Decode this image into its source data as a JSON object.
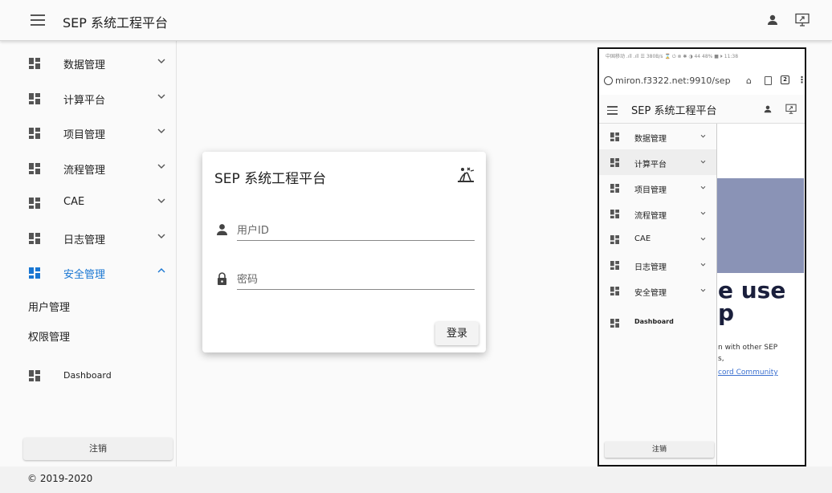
{
  "appbar": {
    "title": "SEP 系统工程平台",
    "icons": [
      "menu-icon",
      "user-icon",
      "screen-share-icon"
    ]
  },
  "sidebar": {
    "items": [
      {
        "label": "数据管理",
        "icon": "dashboard-grid-icon",
        "expanded": false
      },
      {
        "label": "计算平台",
        "icon": "dashboard-grid-icon",
        "expanded": false
      },
      {
        "label": "项目管理",
        "icon": "dashboard-grid-icon",
        "expanded": false
      },
      {
        "label": "流程管理",
        "icon": "dashboard-grid-icon",
        "expanded": false
      },
      {
        "label": "CAE",
        "icon": "dashboard-grid-icon",
        "expanded": false
      },
      {
        "label": "日志管理",
        "icon": "dashboard-grid-icon",
        "expanded": false
      },
      {
        "label": "安全管理",
        "icon": "dashboard-grid-icon",
        "expanded": true
      }
    ],
    "sub_items": [
      "用户管理",
      "权限管理"
    ],
    "dashboard_label": "Dashboard",
    "logout_label": "注销",
    "active_color": "#1976d2"
  },
  "login_card": {
    "title": "SEP 系统工程平台",
    "user_placeholder": "用户ID",
    "password_placeholder": "密码",
    "login_label": "登录"
  },
  "footer": {
    "copyright": "© 2019-2020"
  },
  "phone": {
    "statusbar": "中国移动 .ıll .ıll ☰ 380B/s ⌛ ⏻ ⊗ ✱ ◑ 44 48% ■ ⏵ 11:38",
    "url": "miron.f3322.net:9910/sep",
    "tab_count": "2",
    "title": "SEP 系统工程平台",
    "items": [
      "数据管理",
      "计算平台",
      "项目管理",
      "流程管理",
      "CAE",
      "日志管理",
      "安全管理",
      "Dashboard"
    ],
    "logout_label": "注销",
    "bg_text": "e use",
    "bg_text2": "p",
    "bg_small1": "n with other SEP",
    "bg_small2": "s,",
    "bg_link": "cord Community"
  }
}
